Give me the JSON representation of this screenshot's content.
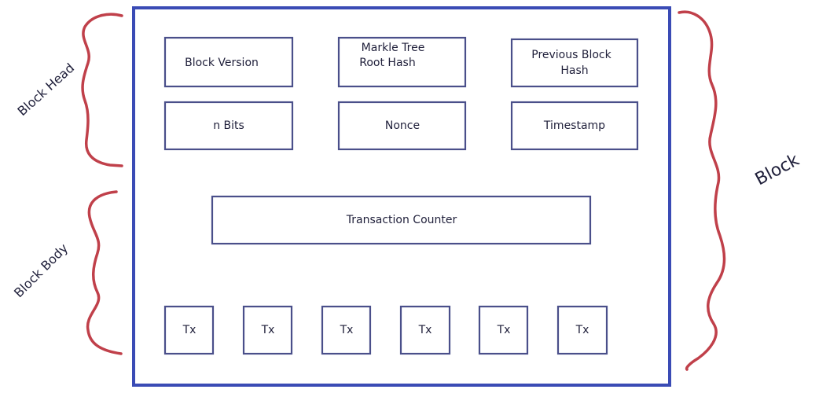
{
  "colors": {
    "outer_frame": "#3a4bb5",
    "inner_box": "#4a4f8a",
    "brace": "#c0404a",
    "text": "#1f1f3a"
  },
  "labels": {
    "block": "Block",
    "block_head": "Block Head",
    "block_body": "Block Body"
  },
  "head_fields": {
    "block_version": "Block Version",
    "merkle_line1": "Markle Tree",
    "merkle_line2": "Root Hash",
    "prev_line1": "Previous Block",
    "prev_line2": "Hash",
    "n_bits": "n Bits",
    "nonce": "Nonce",
    "timestamp": "Timestamp"
  },
  "body_fields": {
    "transaction_counter": "Transaction Counter",
    "transactions": [
      "Tx",
      "Tx",
      "Tx",
      "Tx",
      "Tx",
      "Tx"
    ]
  }
}
